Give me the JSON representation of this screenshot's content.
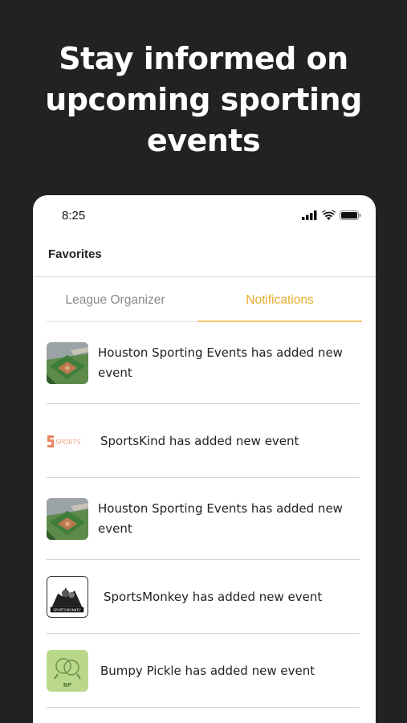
{
  "headline": {
    "line1": "Stay informed on",
    "line2": "upcoming sporting",
    "line3": "events"
  },
  "status_bar": {
    "time": "8:25",
    "icons": [
      "signal-icon",
      "wifi-icon",
      "battery-icon"
    ]
  },
  "nav": {
    "title": "Favorites"
  },
  "tabs": [
    {
      "label": "League Organizer",
      "active": false
    },
    {
      "label": "Notifications",
      "active": true
    }
  ],
  "notifications": [
    {
      "logo": "houston-sporting-events-logo",
      "text": "Houston Sporting Events has added new event"
    },
    {
      "logo": "sportskind-logo",
      "text": "SportsKind has added new event"
    },
    {
      "logo": "houston-sporting-events-logo",
      "text": "Houston Sporting Events has added new event"
    },
    {
      "logo": "sportsmonkey-logo",
      "text": "SportsMonkey has added new event"
    },
    {
      "logo": "bumpy-pickle-logo",
      "text": "Bumpy Pickle has added new event"
    }
  ],
  "logo_text": {
    "sportskind": "SPORTS",
    "sportsmonkey": "SPORTSMONKEY",
    "bumpy_pickle": "BP"
  },
  "colors": {
    "background": "#222222",
    "accent": "#e8ac2c",
    "tab_inactive": "#8a8a8a"
  }
}
